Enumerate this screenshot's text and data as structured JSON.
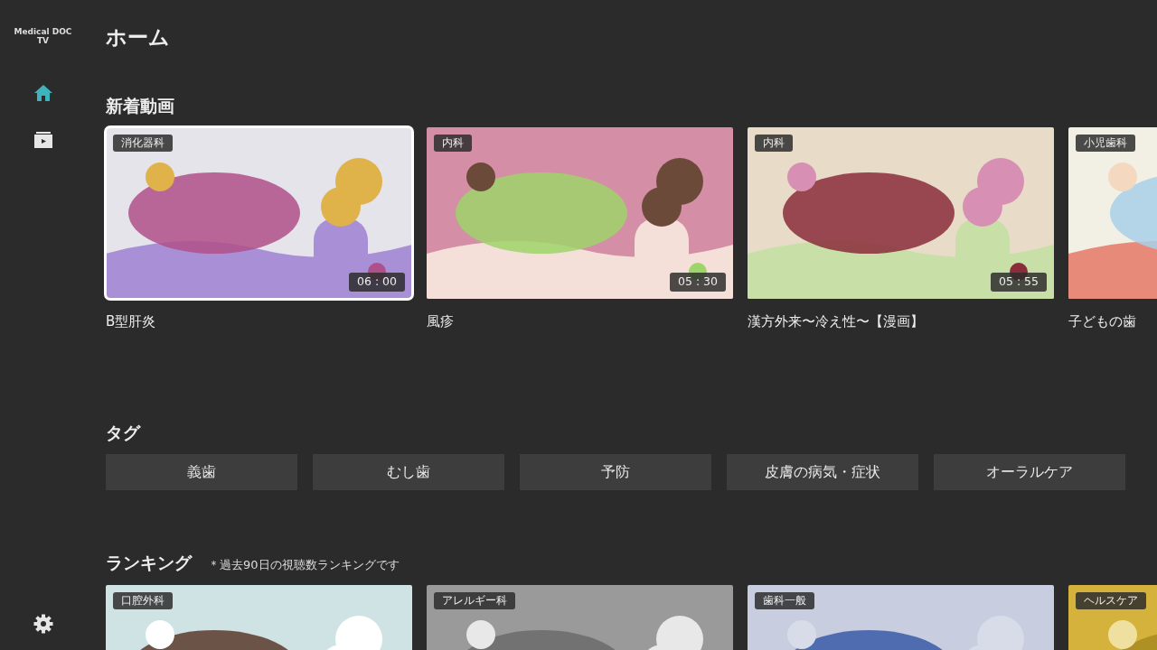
{
  "sidebar": {
    "logo_lines": [
      "Medical DOC",
      "TV"
    ],
    "nav": [
      {
        "kind": "home",
        "selected": true
      },
      {
        "kind": "library",
        "selected": false
      }
    ],
    "settings": {
      "kind": "settings"
    }
  },
  "page_title": "ホーム",
  "new_videos": {
    "title": "新着動画",
    "items": [
      {
        "category": "消化器科",
        "duration": "06 : 00",
        "title": "B型肝炎",
        "focused": true
      },
      {
        "category": "内科",
        "duration": "05 : 30",
        "title": "風疹",
        "focused": false
      },
      {
        "category": "内科",
        "duration": "05 : 55",
        "title": "漢方外来〜冷え性〜【漫画】",
        "focused": false
      },
      {
        "category": "小児歯科",
        "title": "子どもの歯",
        "focused": false
      }
    ]
  },
  "tags": {
    "title": "タグ",
    "items": [
      "義歯",
      "むし歯",
      "予防",
      "皮膚の病気・症状",
      "オーラルケア"
    ]
  },
  "ranking": {
    "title": "ランキング",
    "note": "＊過去90日の視聴数ランキングです",
    "items": [
      {
        "category": "口腔外科"
      },
      {
        "category": "アレルギー科"
      },
      {
        "category": "歯科一般"
      },
      {
        "category": "ヘルスケア"
      }
    ]
  }
}
